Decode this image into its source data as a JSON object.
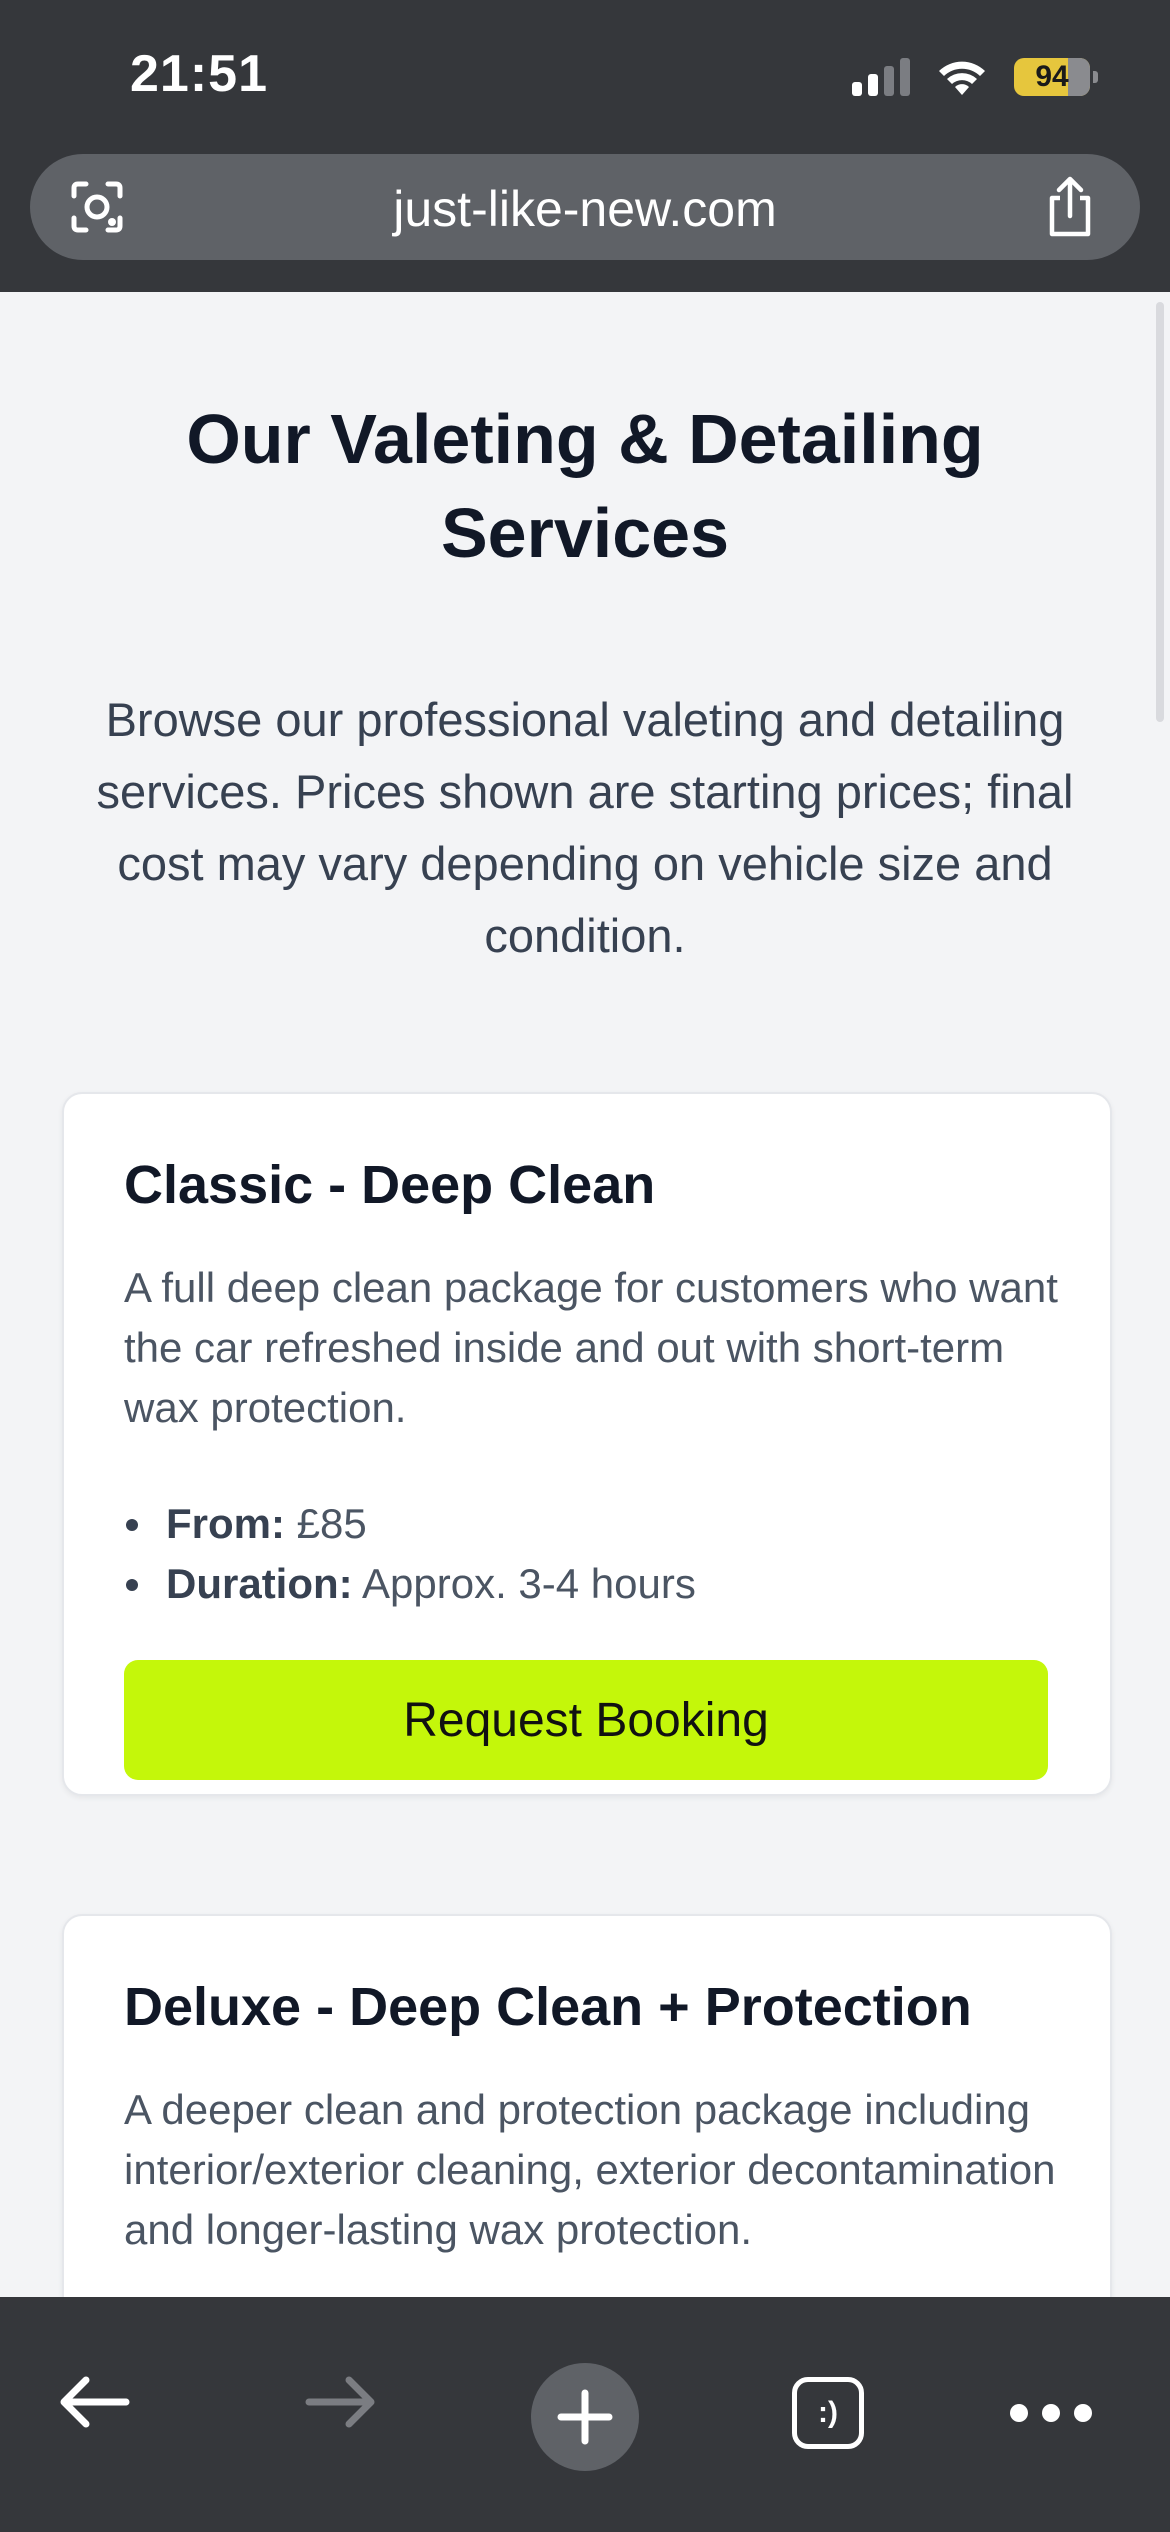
{
  "status_bar": {
    "time": "21:51",
    "battery": "94",
    "icons": [
      "signal-icon",
      "wifi-icon",
      "battery-charging-icon"
    ]
  },
  "browser": {
    "url": "just-like-new.com",
    "left_icon": "lens-icon",
    "right_icon": "share-icon"
  },
  "page": {
    "title": "Our Valeting & Detailing Services",
    "intro": "Browse our professional valeting and detailing services. Prices shown are starting prices; final cost may vary depending on vehicle size and condition."
  },
  "services": [
    {
      "name": "Classic - Deep Clean",
      "description": "A full deep clean package for customers who want the car refreshed inside and out with short-term wax protection.",
      "from_label": "From:",
      "from_value": "£85",
      "duration_label": "Duration:",
      "duration_value": "Approx. 3-4 hours",
      "button": "Request Booking"
    },
    {
      "name": "Deluxe - Deep Clean + Protection",
      "description": "A deeper clean and protection package including interior/exterior cleaning, exterior decontamination and longer-lasting wax protection."
    }
  ],
  "toolbar": {
    "tabs_label": ":)",
    "icons": [
      "back-arrow-icon",
      "forward-arrow-icon",
      "plus-icon",
      "tabs-icon",
      "more-icon"
    ]
  },
  "colors": {
    "accent": "#c4f70a",
    "chrome": "#35373b",
    "page_bg": "#f3f4f6"
  }
}
